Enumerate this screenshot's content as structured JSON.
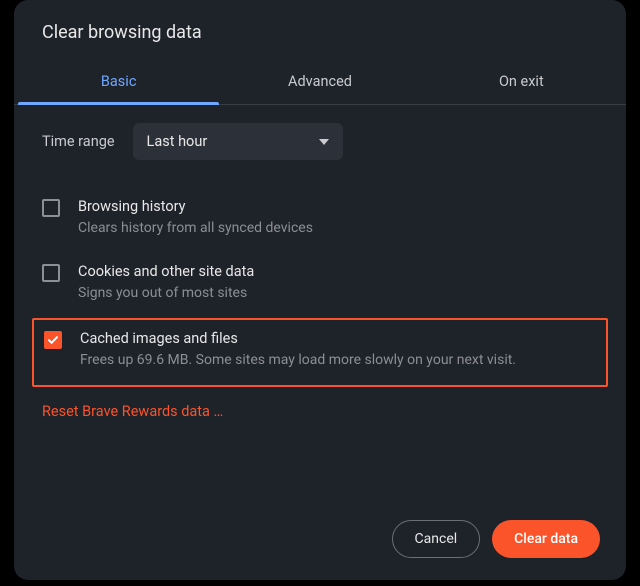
{
  "dialog": {
    "title": "Clear browsing data",
    "tabs": {
      "basic": "Basic",
      "advanced": "Advanced",
      "onexit": "On exit"
    },
    "range": {
      "label": "Time range",
      "selected": "Last hour"
    },
    "options": {
      "history": {
        "title": "Browsing history",
        "desc": "Clears history from all synced devices",
        "checked": false
      },
      "cookies": {
        "title": "Cookies and other site data",
        "desc": "Signs you out of most sites",
        "checked": false
      },
      "cache": {
        "title": "Cached images and files",
        "desc": "Frees up 69.6 MB. Some sites may load more slowly on your next visit.",
        "checked": true
      }
    },
    "reset_link": "Reset Brave Rewards data …",
    "buttons": {
      "cancel": "Cancel",
      "clear": "Clear data"
    }
  }
}
